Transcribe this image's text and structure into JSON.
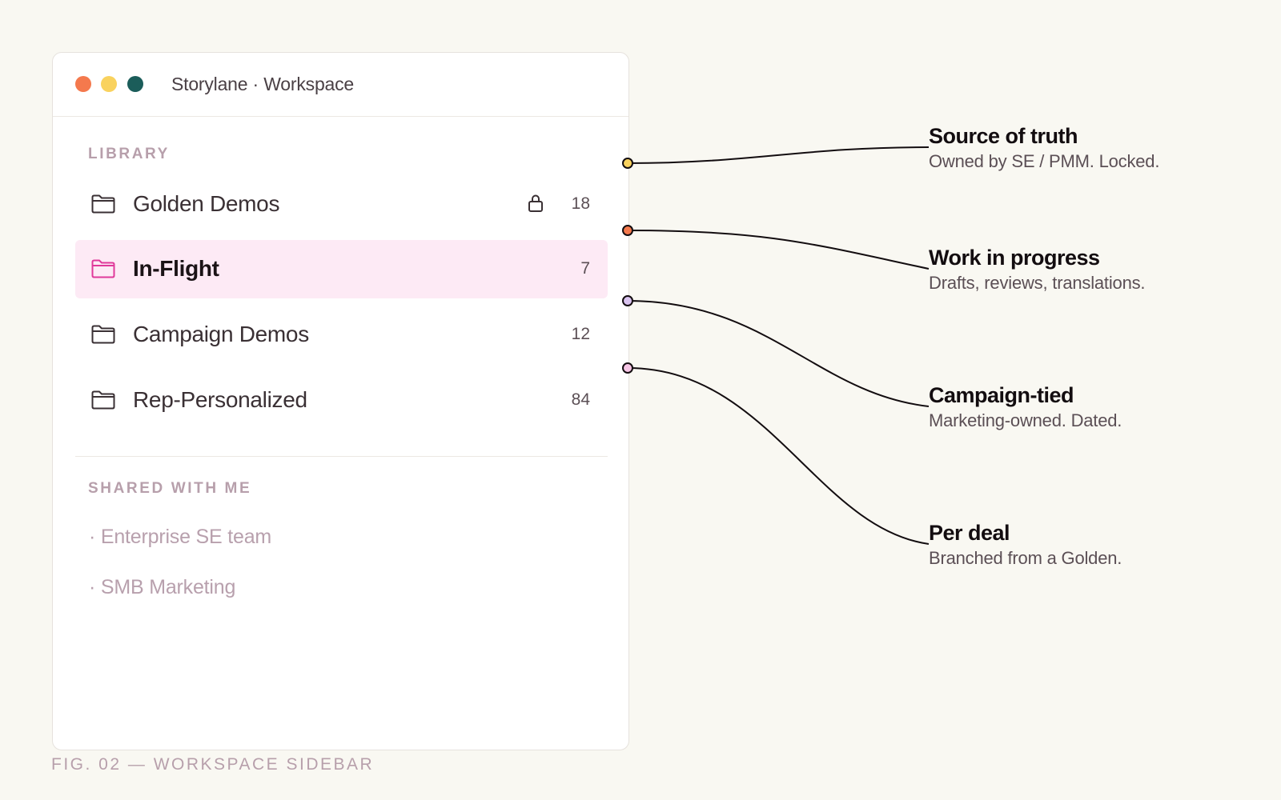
{
  "window": {
    "title": "Storylane · Workspace"
  },
  "library": {
    "section_label": "LIBRARY",
    "items": [
      {
        "label": "Golden Demos",
        "count": "18",
        "locked": true,
        "active": false,
        "icon": "folder-icon"
      },
      {
        "label": "In-Flight",
        "count": "7",
        "locked": false,
        "active": true,
        "icon": "folder-icon"
      },
      {
        "label": "Campaign Demos",
        "count": "12",
        "locked": false,
        "active": false,
        "icon": "folder-icon"
      },
      {
        "label": "Rep-Personalized",
        "count": "84",
        "locked": false,
        "active": false,
        "icon": "folder-icon"
      }
    ]
  },
  "shared": {
    "section_label": "SHARED WITH ME",
    "items": [
      {
        "label": "· Enterprise SE team"
      },
      {
        "label": "· SMB Marketing"
      }
    ]
  },
  "annotations": [
    {
      "title": "Source of truth",
      "subtitle": "Owned by SE / PMM. Locked.",
      "color": "#f9d25e"
    },
    {
      "title": "Work in progress",
      "subtitle": "Drafts, reviews, translations.",
      "color": "#f4794d"
    },
    {
      "title": "Campaign-tied",
      "subtitle": "Marketing-owned. Dated.",
      "color": "#d9c3ef"
    },
    {
      "title": "Per deal",
      "subtitle": "Branched from a Golden.",
      "color": "#f7c6e6"
    }
  ],
  "caption": "FIG. 02 — WORKSPACE SIDEBAR",
  "colors": {
    "background": "#f9f8f2",
    "active_bg": "#fdeaf5",
    "active_accent": "#e0399a",
    "muted_label": "#b79fab"
  }
}
